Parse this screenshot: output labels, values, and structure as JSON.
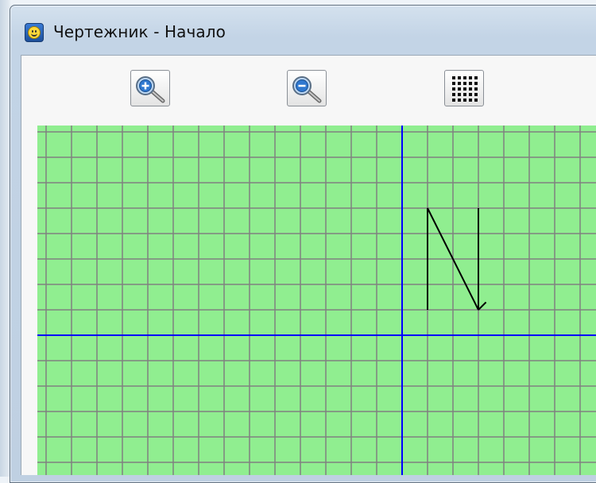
{
  "window": {
    "title": "Чертежник - Начало",
    "icon": "smiley-app-icon"
  },
  "toolbar": {
    "buttons": [
      {
        "name": "zoom-in-button",
        "icon": "zoom-in-icon"
      },
      {
        "name": "zoom-out-button",
        "icon": "zoom-out-icon"
      },
      {
        "name": "grid-toggle-button",
        "icon": "grid-dots-icon"
      }
    ]
  },
  "drawing": {
    "background_color": "#90ee90",
    "grid_line_color": "#808080",
    "axis_color": "#0000ff",
    "pen_color": "#000000",
    "path": [
      [
        1,
        1
      ],
      [
        1,
        5
      ],
      [
        3,
        1
      ],
      [
        3,
        5
      ]
    ],
    "segment": [
      [
        3,
        1
      ],
      [
        3.3,
        1.3
      ]
    ]
  }
}
